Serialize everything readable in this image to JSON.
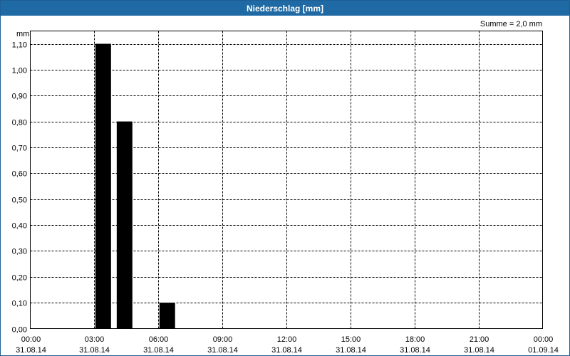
{
  "window": {
    "title": "Niederschlag [mm]"
  },
  "chart_data": {
    "type": "bar",
    "title": "Niederschlag [mm]",
    "ylabel": "mm",
    "sum_label": "Summe = 2,0 mm",
    "ylim": [
      0,
      1.1
    ],
    "yticks": [
      {
        "value": 0.0,
        "label": "0,00"
      },
      {
        "value": 0.1,
        "label": "0,10"
      },
      {
        "value": 0.2,
        "label": "0,20"
      },
      {
        "value": 0.3,
        "label": "0,30"
      },
      {
        "value": 0.4,
        "label": "0,40"
      },
      {
        "value": 0.5,
        "label": "0,50"
      },
      {
        "value": 0.6,
        "label": "0,60"
      },
      {
        "value": 0.7,
        "label": "0,70"
      },
      {
        "value": 0.8,
        "label": "0,80"
      },
      {
        "value": 0.9,
        "label": "0,90"
      },
      {
        "value": 1.0,
        "label": "1,00"
      },
      {
        "value": 1.1,
        "label": "1,10"
      }
    ],
    "xlim_hours": [
      0,
      24
    ],
    "xticks": [
      {
        "hour": 0,
        "time": "00:00",
        "date": "31.08.14"
      },
      {
        "hour": 3,
        "time": "03:00",
        "date": "31.08.14"
      },
      {
        "hour": 6,
        "time": "06:00",
        "date": "31.08.14"
      },
      {
        "hour": 9,
        "time": "09:00",
        "date": "31.08.14"
      },
      {
        "hour": 12,
        "time": "12:00",
        "date": "31.08.14"
      },
      {
        "hour": 15,
        "time": "15:00",
        "date": "31.08.14"
      },
      {
        "hour": 18,
        "time": "18:00",
        "date": "31.08.14"
      },
      {
        "hour": 21,
        "time": "21:00",
        "date": "31.08.14"
      },
      {
        "hour": 24,
        "time": "00:00",
        "date": "01.09.14"
      }
    ],
    "bars": [
      {
        "hour": 3,
        "value": 1.1
      },
      {
        "hour": 4,
        "value": 0.8
      },
      {
        "hour": 6,
        "value": 0.1
      }
    ],
    "bar_color": "#000000",
    "grid": true
  }
}
